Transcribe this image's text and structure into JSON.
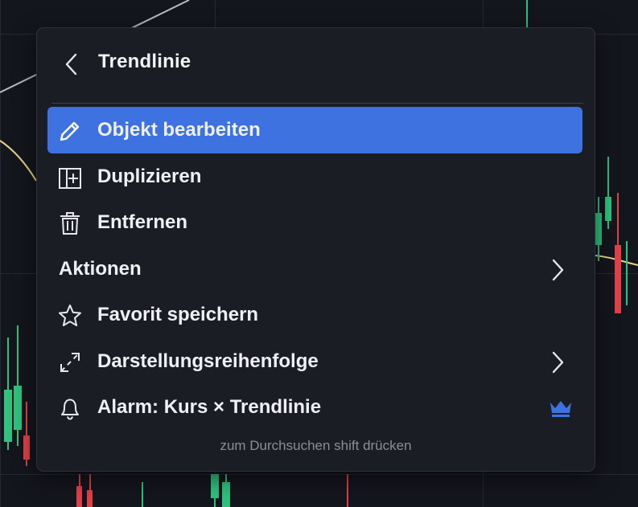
{
  "menu": {
    "title": "Trendlinie",
    "items": [
      {
        "label": "Objekt bearbeiten",
        "icon": "pencil-icon",
        "active": true
      },
      {
        "label": "Duplizieren",
        "icon": "duplicate-icon"
      },
      {
        "label": "Entfernen",
        "icon": "trash-icon"
      },
      {
        "label": "Aktionen",
        "icon": "",
        "submenu": true
      },
      {
        "label": "Favorit speichern",
        "icon": "star-icon"
      },
      {
        "label": "Darstellungsreihenfolge",
        "icon": "arrows-diagonal-icon",
        "submenu": true
      },
      {
        "label": "Alarm: Kurs × Trendlinie",
        "icon": "bell-icon",
        "badge": "crown-icon"
      }
    ],
    "hint": "zum Durchsuchen shift drücken"
  },
  "colors": {
    "active_bg": "#3d72e0",
    "crown": "#3d72e0",
    "candle_up": "#2ec27e",
    "candle_down": "#e0404a",
    "trendline": "#e8d28a"
  }
}
